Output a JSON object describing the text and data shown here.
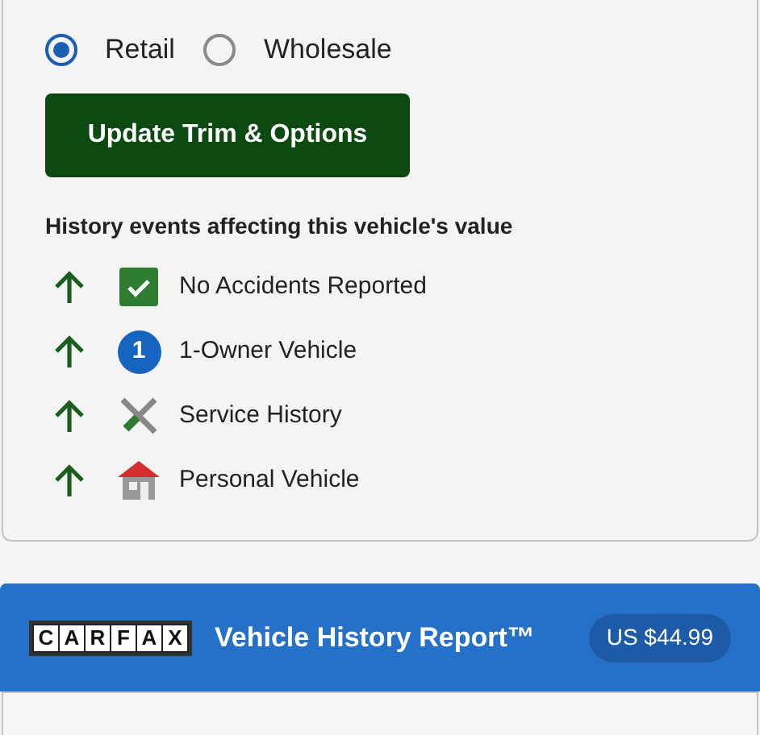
{
  "price_type": [
    {
      "label": "Retail",
      "selected": true
    },
    {
      "label": "Wholesale",
      "selected": false
    }
  ],
  "update_button": "Update Trim & Options",
  "history": {
    "heading": "History events affecting this vehicle's value",
    "events": [
      {
        "kind": "check",
        "label": "No Accidents Reported"
      },
      {
        "kind": "badge",
        "badge": "1",
        "label": "1-Owner Vehicle"
      },
      {
        "kind": "tools",
        "label": "Service History"
      },
      {
        "kind": "house",
        "label": "Personal Vehicle"
      }
    ]
  },
  "report": {
    "logo_letters": [
      "C",
      "A",
      "R",
      "F",
      "A",
      "X"
    ],
    "title": "Vehicle History Report™",
    "price": "US $44.99"
  }
}
